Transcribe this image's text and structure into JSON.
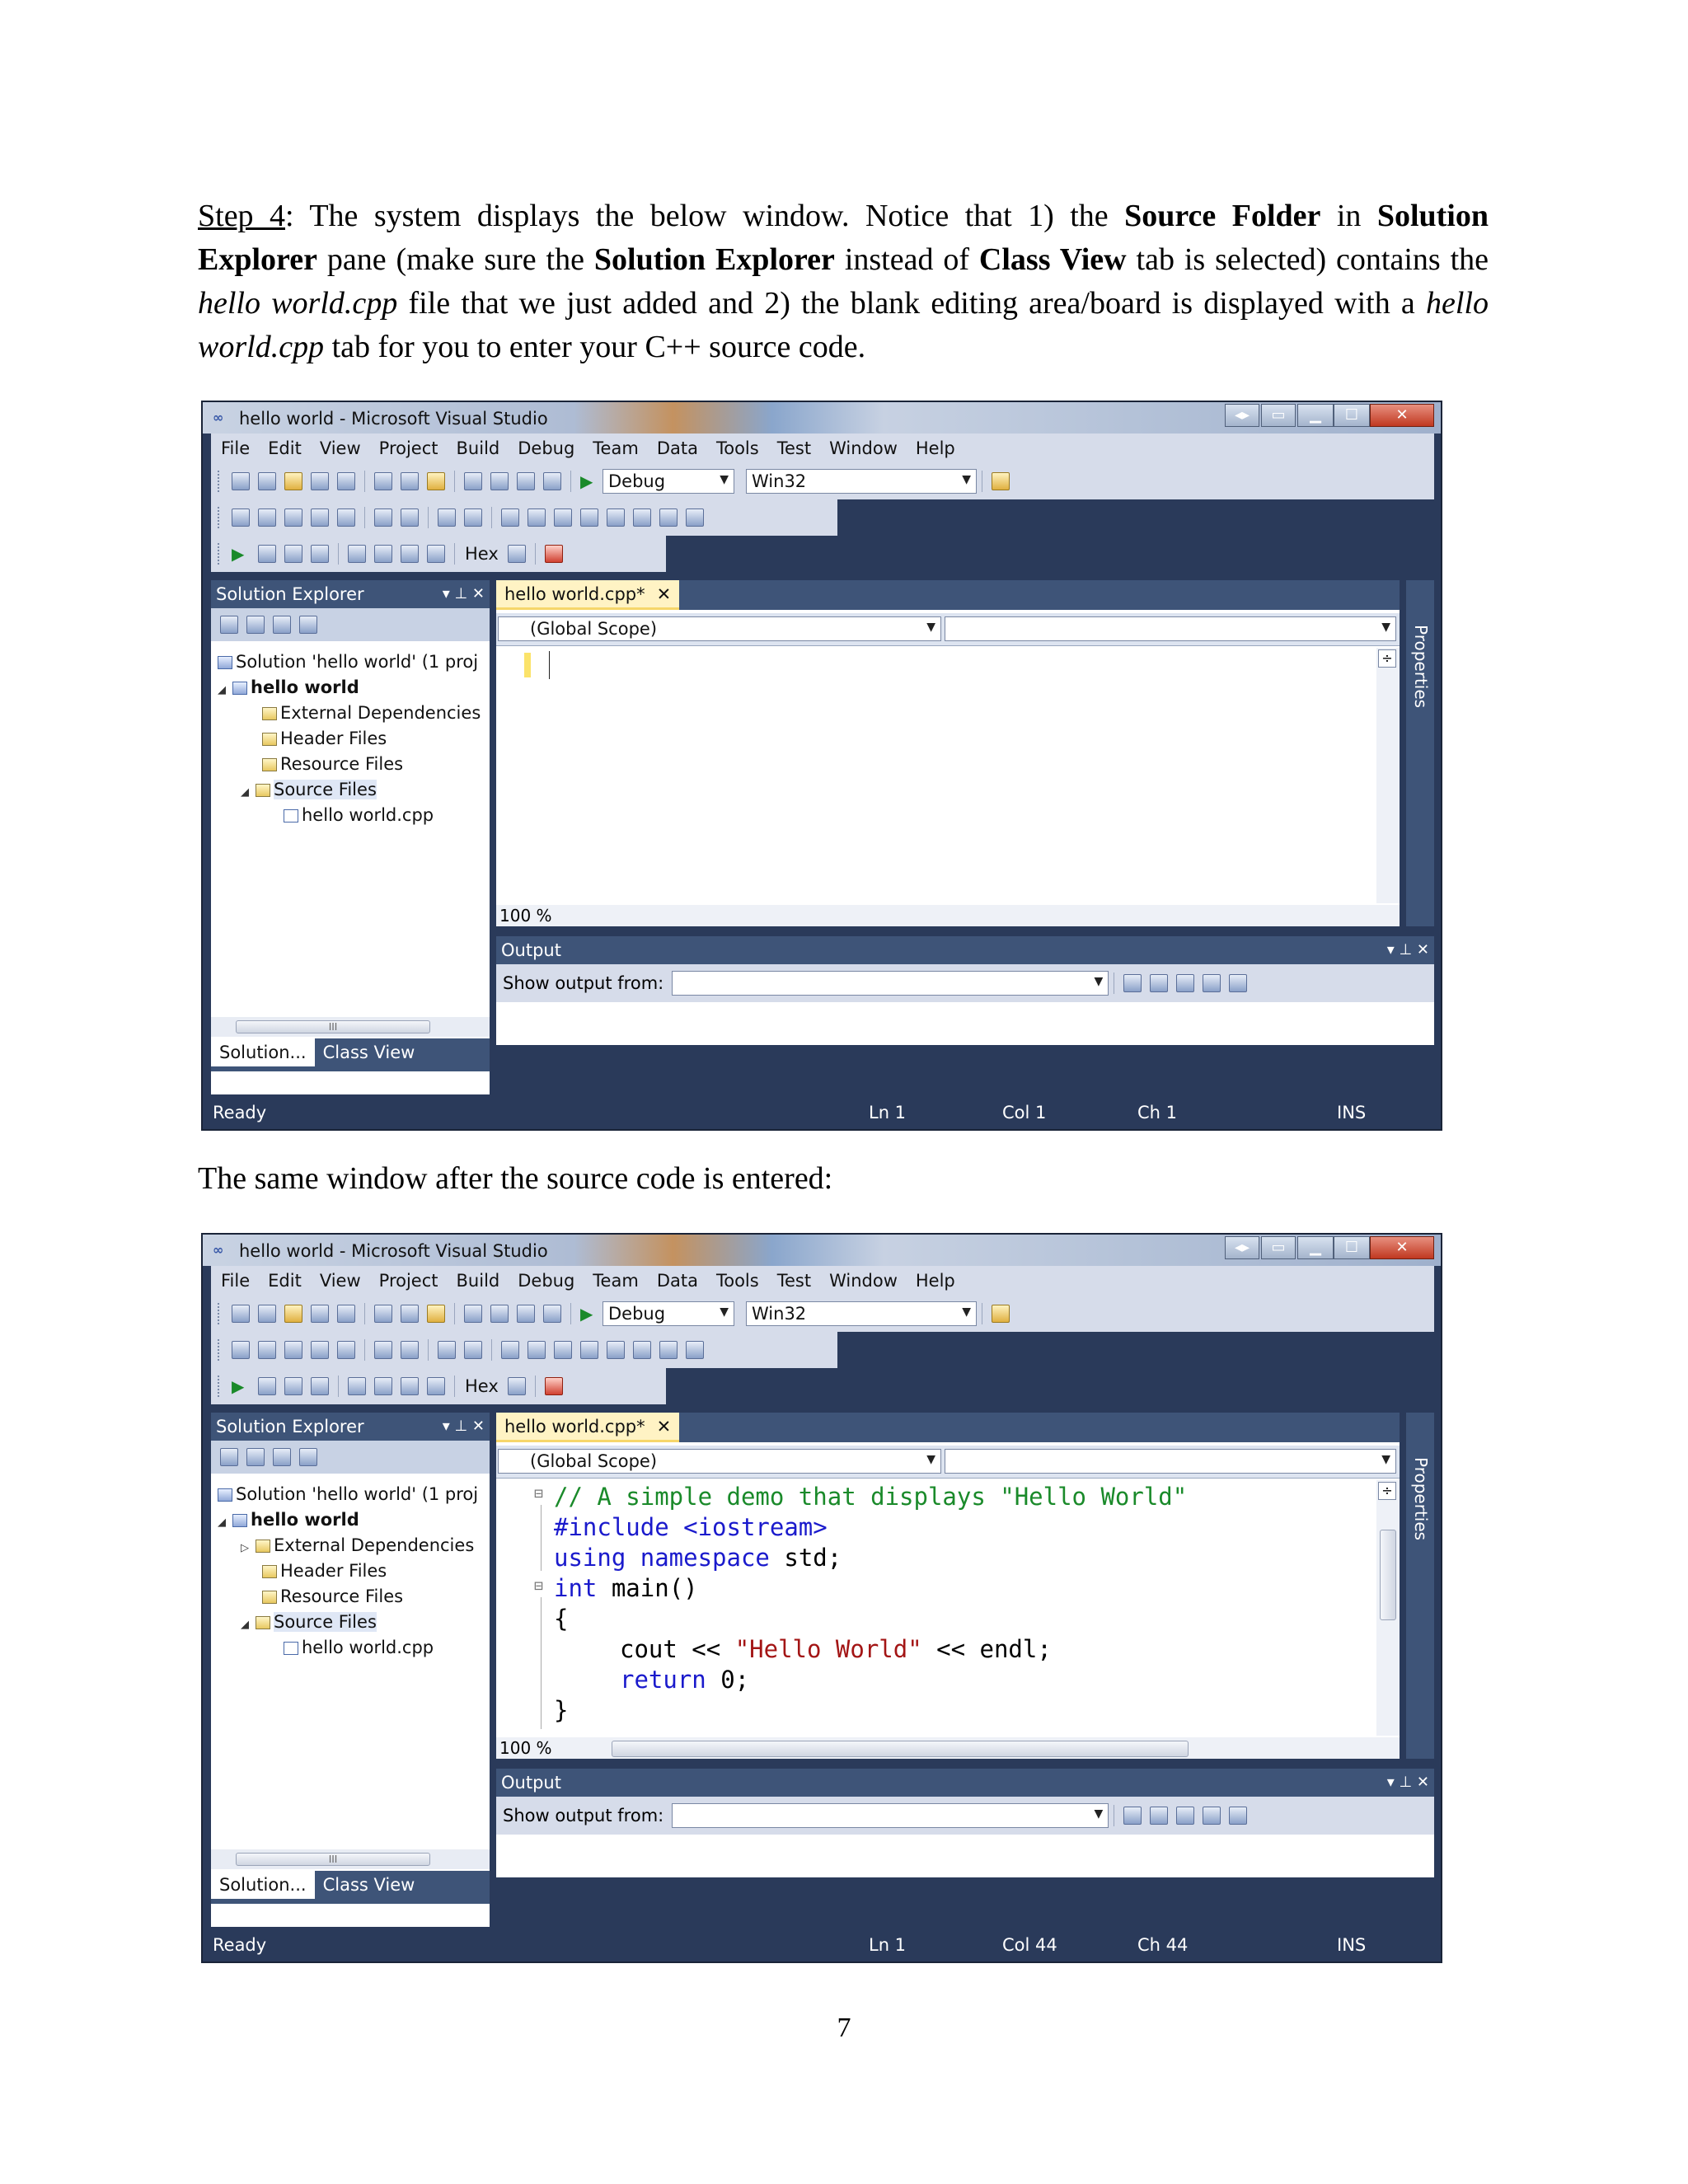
{
  "text": {
    "step_label": "Step 4",
    "p1_a": ": The system displays the below window.  Notice that 1) the ",
    "p1_b": "Source Folder",
    "p1_c": " in ",
    "p1_d": "Solution Explorer",
    "p1_e": " pane (make sure the ",
    "p1_f": "Solution Explorer",
    "p1_g": " instead of ",
    "p1_h": "Class View",
    "p1_i": " tab is selected) contains the ",
    "p1_j": "hello world.cpp",
    "p1_k": " file that we just added and 2) the blank editing area/board is displayed with a ",
    "p1_l": "hello world.cpp",
    "p1_m": " tab for you to enter your C++ source code.",
    "p2": "The same window after the source code is entered:",
    "page_number": "7"
  },
  "window": {
    "title": "hello world - Microsoft Visual Studio",
    "menu": [
      "File",
      "Edit",
      "View",
      "Project",
      "Build",
      "Debug",
      "Team",
      "Data",
      "Tools",
      "Test",
      "Window",
      "Help"
    ],
    "config": "Debug",
    "platform": "Win32",
    "hex_label": "Hex",
    "solution_explorer": {
      "title": "Solution Explorer",
      "tree": [
        "Solution 'hello world' (1 proj",
        "hello world",
        "External Dependencies",
        "Header Files",
        "Resource Files",
        "Source Files",
        "hello world.cpp"
      ],
      "tab_solution": "Solution...",
      "tab_classview": "Class View",
      "scroll_mark": "III"
    },
    "editor": {
      "tab": "hello world.cpp*",
      "scope": "(Global Scope)",
      "zoom": "100 %"
    },
    "properties_label": "Properties",
    "output": {
      "title": "Output",
      "show_from": "Show output from:"
    }
  },
  "code": {
    "l1_comment": "// A simple demo that displays \"Hello World\"",
    "l2_include": "#include <iostream>",
    "l3_using": "using namespace",
    "l3_std": " std;",
    "l4_int": "int",
    "l4_main": " main()",
    "l5": "{",
    "l6_cout": "cout << ",
    "l6_str": "\"Hello World\"",
    "l6_end": " << endl;",
    "l7_return": "return",
    "l7_val": " 0;",
    "l8": "}"
  },
  "status1": {
    "ready": "Ready",
    "ln": "Ln 1",
    "col": "Col 1",
    "ch": "Ch 1",
    "ins": "INS"
  },
  "status2": {
    "ready": "Ready",
    "ln": "Ln 1",
    "col": "Col 44",
    "ch": "Ch 44",
    "ins": "INS"
  }
}
